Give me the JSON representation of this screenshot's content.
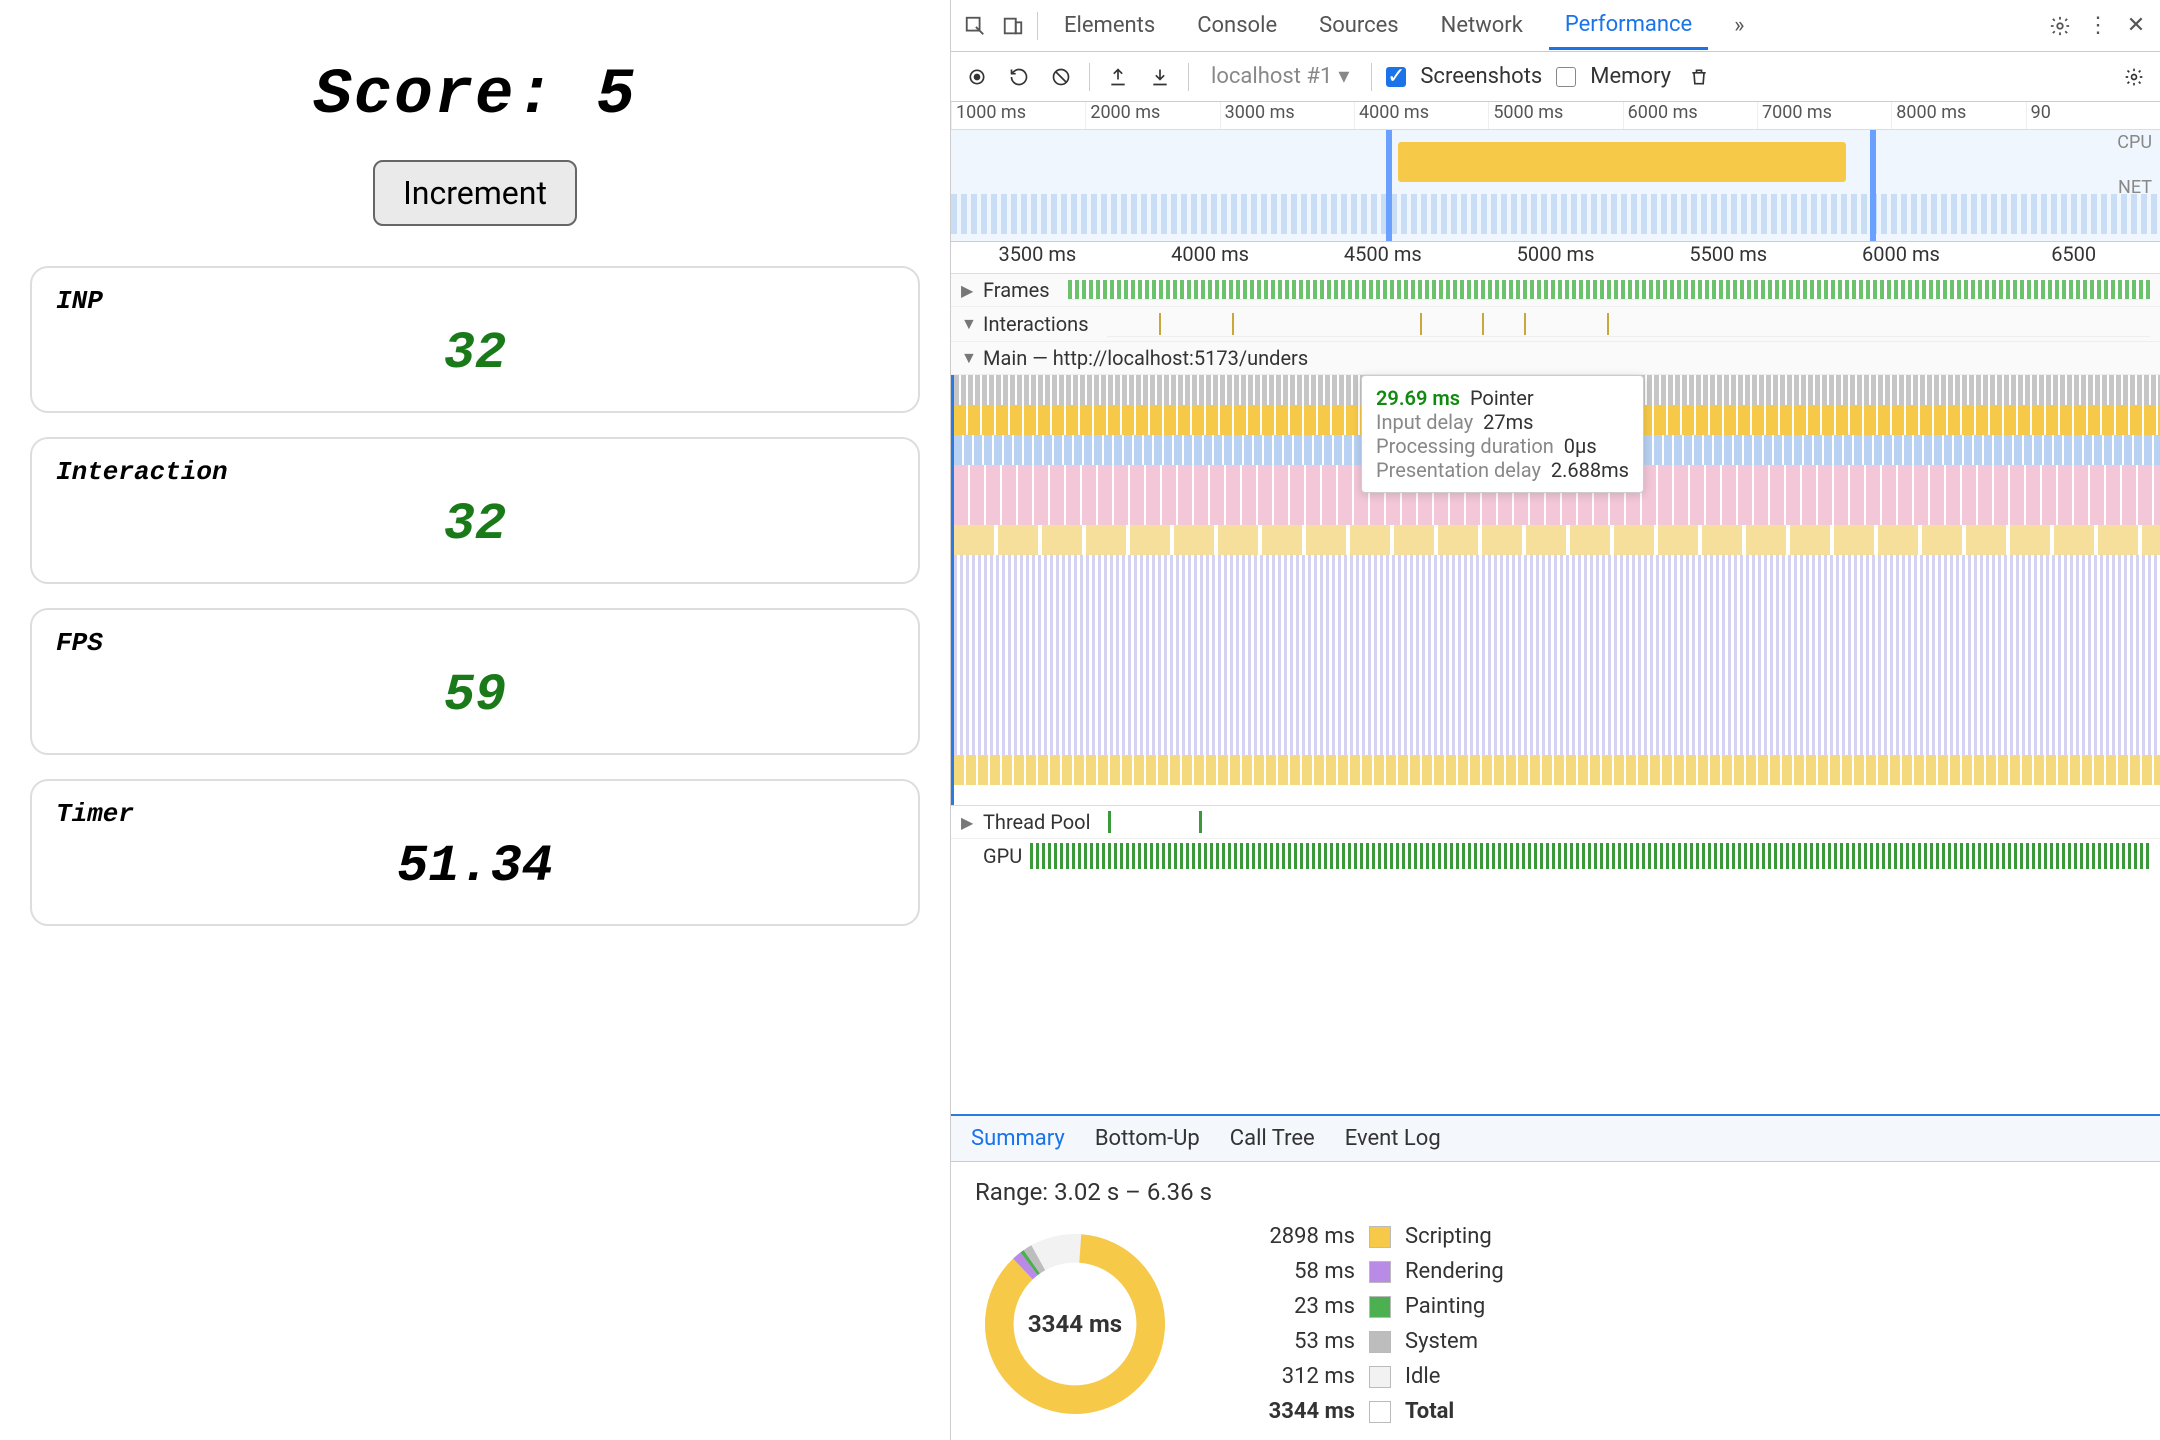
{
  "app": {
    "score_label": "Score:",
    "score_value": "5",
    "increment_label": "Increment",
    "cards": [
      {
        "label": "INP",
        "value": "32",
        "color": "green"
      },
      {
        "label": "Interaction",
        "value": "32",
        "color": "green"
      },
      {
        "label": "FPS",
        "value": "59",
        "color": "green"
      },
      {
        "label": "Timer",
        "value": "51.34",
        "color": "black"
      }
    ]
  },
  "devtools": {
    "panels": [
      "Elements",
      "Console",
      "Sources",
      "Network",
      "Performance"
    ],
    "active_panel": "Performance",
    "more_tabs": "»",
    "toolbar": {
      "profile_dropdown": "localhost #1",
      "screenshots_label": "Screenshots",
      "screenshots_checked": true,
      "memory_label": "Memory",
      "memory_checked": false
    },
    "overview_ruler": [
      "1000 ms",
      "2000 ms",
      "3000 ms",
      "4000 ms",
      "5000 ms",
      "6000 ms",
      "7000 ms",
      "8000 ms",
      "90"
    ],
    "overview_labels": {
      "cpu": "CPU",
      "net": "NET"
    },
    "main_ruler": [
      "3500 ms",
      "4000 ms",
      "4500 ms",
      "5000 ms",
      "5500 ms",
      "6000 ms",
      "6500"
    ],
    "tracks": {
      "frames": "Frames",
      "interactions": "Interactions",
      "main": "Main — http://localhost:5173/unders",
      "thread_pool": "Thread Pool",
      "gpu": "GPU"
    },
    "tooltip": {
      "time": "29.69 ms",
      "type": "Pointer",
      "rows": [
        {
          "label": "Input delay",
          "value": "27ms"
        },
        {
          "label": "Processing duration",
          "value": "0μs"
        },
        {
          "label": "Presentation delay",
          "value": "2.688ms"
        }
      ]
    },
    "bottom_tabs": [
      "Summary",
      "Bottom-Up",
      "Call Tree",
      "Event Log"
    ],
    "active_bottom_tab": "Summary",
    "summary": {
      "range": "Range: 3.02 s – 6.36 s",
      "total_label": "3344 ms",
      "legend": [
        {
          "ms": "2898 ms",
          "name": "Scripting",
          "sw": "sw-script"
        },
        {
          "ms": "58 ms",
          "name": "Rendering",
          "sw": "sw-render"
        },
        {
          "ms": "23 ms",
          "name": "Painting",
          "sw": "sw-paint"
        },
        {
          "ms": "53 ms",
          "name": "System",
          "sw": "sw-system"
        },
        {
          "ms": "312 ms",
          "name": "Idle",
          "sw": "sw-idle"
        },
        {
          "ms": "3344 ms",
          "name": "Total",
          "sw": "sw-total",
          "bold": true
        }
      ]
    }
  },
  "chart_data": {
    "type": "pie",
    "title": "3344 ms",
    "series": [
      {
        "name": "Scripting",
        "value": 2898,
        "color": "#f6c949"
      },
      {
        "name": "Rendering",
        "value": 58,
        "color": "#b98ae6"
      },
      {
        "name": "Painting",
        "value": 23,
        "color": "#4caf50"
      },
      {
        "name": "System",
        "value": 53,
        "color": "#bdbdbd"
      },
      {
        "name": "Idle",
        "value": 312,
        "color": "#f2f2f2"
      }
    ],
    "total": 3344,
    "donut_inner_radius_ratio": 0.62
  }
}
